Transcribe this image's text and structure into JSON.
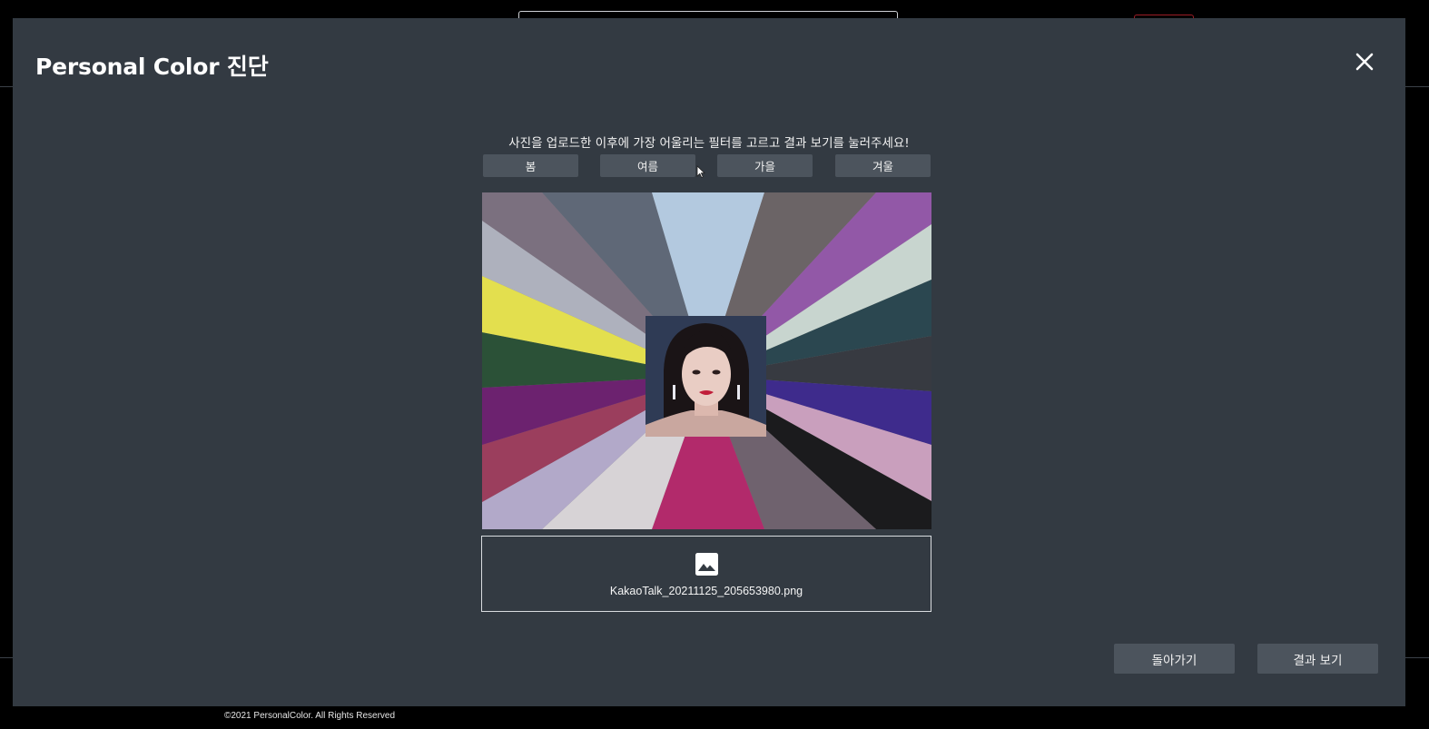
{
  "modal": {
    "title": "Personal Color 진단",
    "instruction": "사진을 업로드한 이후에 가장 어울리는 필터를 고르고 결과 보기를 눌러주세요!",
    "seasons": [
      "봄",
      "여름",
      "가을",
      "겨울"
    ],
    "upload": {
      "file_name": "KakaoTalk_20211125_205653980.png",
      "icon": "image-icon"
    },
    "buttons": {
      "back": "돌아가기",
      "result": "결과 보기"
    },
    "close_icon": "close-icon"
  },
  "footer": {
    "copyright": "©2021 PersonalColor. All Rights Reserved"
  },
  "colors": {
    "modal_bg": "#333a42",
    "button_bg": "#4c545d",
    "page_bg": "#000000",
    "filter_swatches": [
      "#5f6877",
      "#b3c9df",
      "#6b6466",
      "#9258a7",
      "#c8d5cf",
      "#2b4750",
      "#373a41",
      "#3e2b8c",
      "#c99fbd",
      "#1b1b1d",
      "#6f626e",
      "#b22a6b",
      "#d7d3d6",
      "#b2a9c9",
      "#9b3e5d",
      "#6c226f",
      "#2b5137",
      "#e3df4e",
      "#aeb1bd",
      "#7b707f"
    ]
  }
}
